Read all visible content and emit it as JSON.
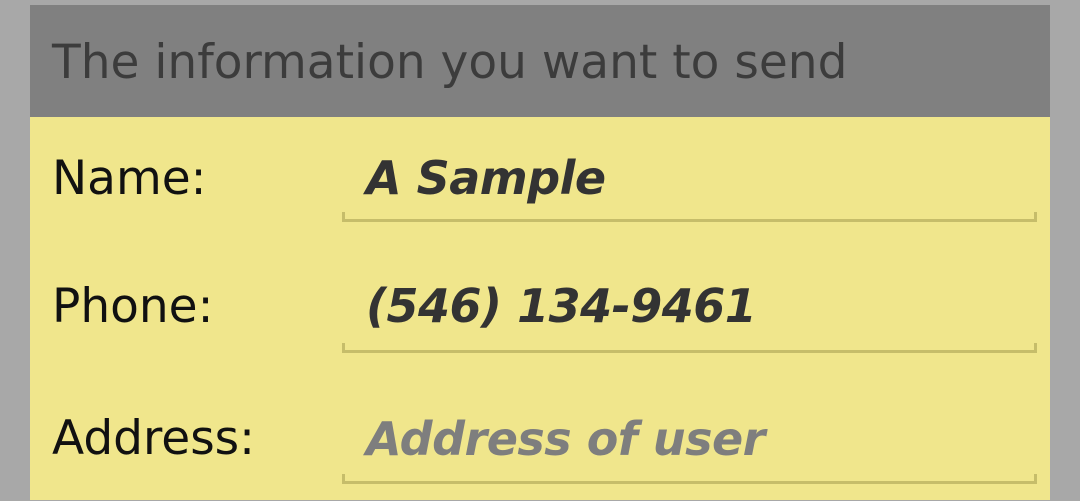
{
  "dialog": {
    "title": "The information you want to send"
  },
  "form": {
    "name": {
      "label": "Name:",
      "value": "A Sample"
    },
    "phone": {
      "label": "Phone:",
      "value": "(546) 134-9461"
    },
    "address": {
      "label": "Address:",
      "value": "",
      "placeholder": "Address of user"
    }
  },
  "colors": {
    "background": "#a8a8a8",
    "panel": "#f0e68c",
    "header": "#808080",
    "underline": "#c6bd6a"
  }
}
